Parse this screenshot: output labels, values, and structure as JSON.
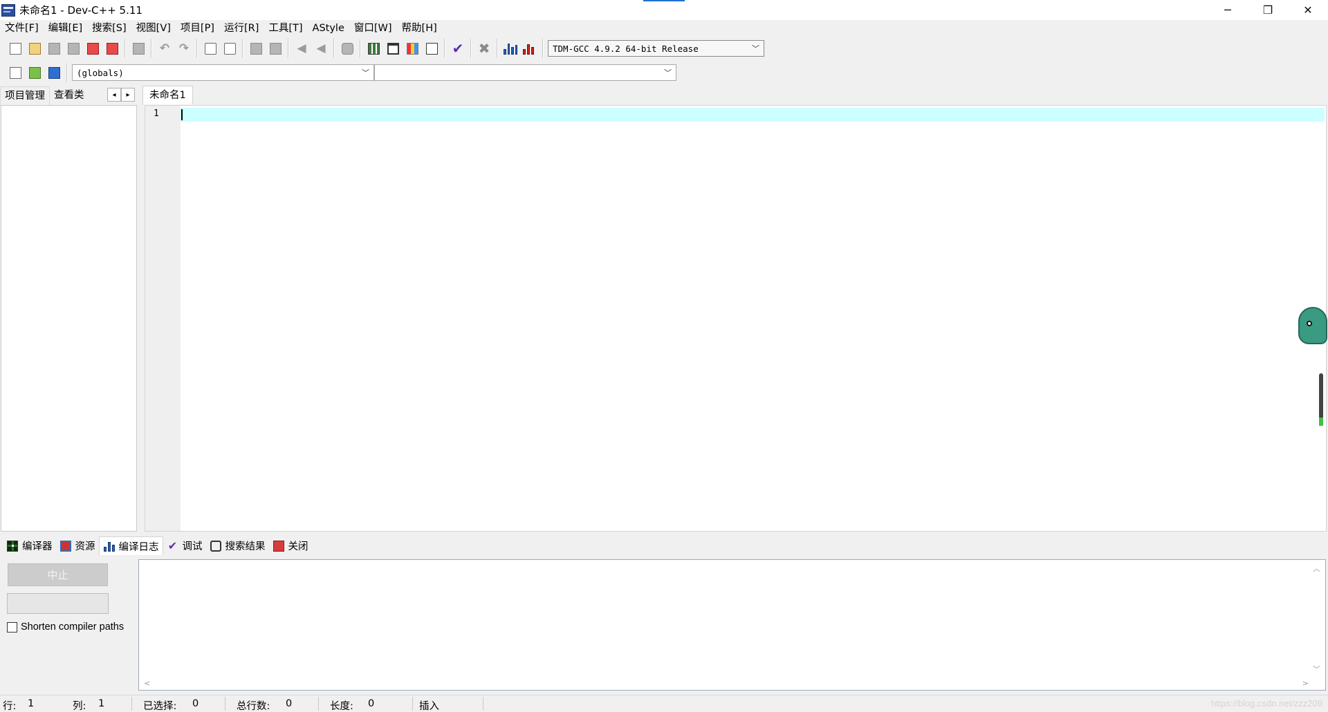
{
  "window": {
    "title": "未命名1 - Dev-C++ 5.11",
    "minimize": "─",
    "restore": "❐",
    "close": "✕"
  },
  "menu": [
    "文件[F]",
    "编辑[E]",
    "搜索[S]",
    "视图[V]",
    "项目[P]",
    "运行[R]",
    "工具[T]",
    "AStyle",
    "窗口[W]",
    "帮助[H]"
  ],
  "toolbar": {
    "compiler_select": "TDM-GCC 4.9.2 64-bit Release",
    "scope_select": "(globals)",
    "function_select": ""
  },
  "left_panel": {
    "tabs": [
      "项目管理",
      "查看类"
    ],
    "prev": "◂",
    "next": "▸"
  },
  "editor": {
    "tab_label": "未命名1",
    "line_number": "1"
  },
  "bottom_panel": {
    "tabs": [
      "编译器",
      "资源",
      "编译日志",
      "调试",
      "搜索结果",
      "关闭"
    ],
    "active_tab": "编译日志",
    "abort_label": "中止",
    "shorten_label": "Shorten compiler paths",
    "shorten_checked": false
  },
  "status": {
    "row_label": "行:",
    "row_value": "1",
    "col_label": "列:",
    "col_value": "1",
    "sel_label": "已选择:",
    "sel_value": "0",
    "lines_label": "总行数:",
    "lines_value": "0",
    "len_label": "长度:",
    "len_value": "0",
    "mode": "插入"
  },
  "watermark": "https://blog.csdn.net/zzz209"
}
